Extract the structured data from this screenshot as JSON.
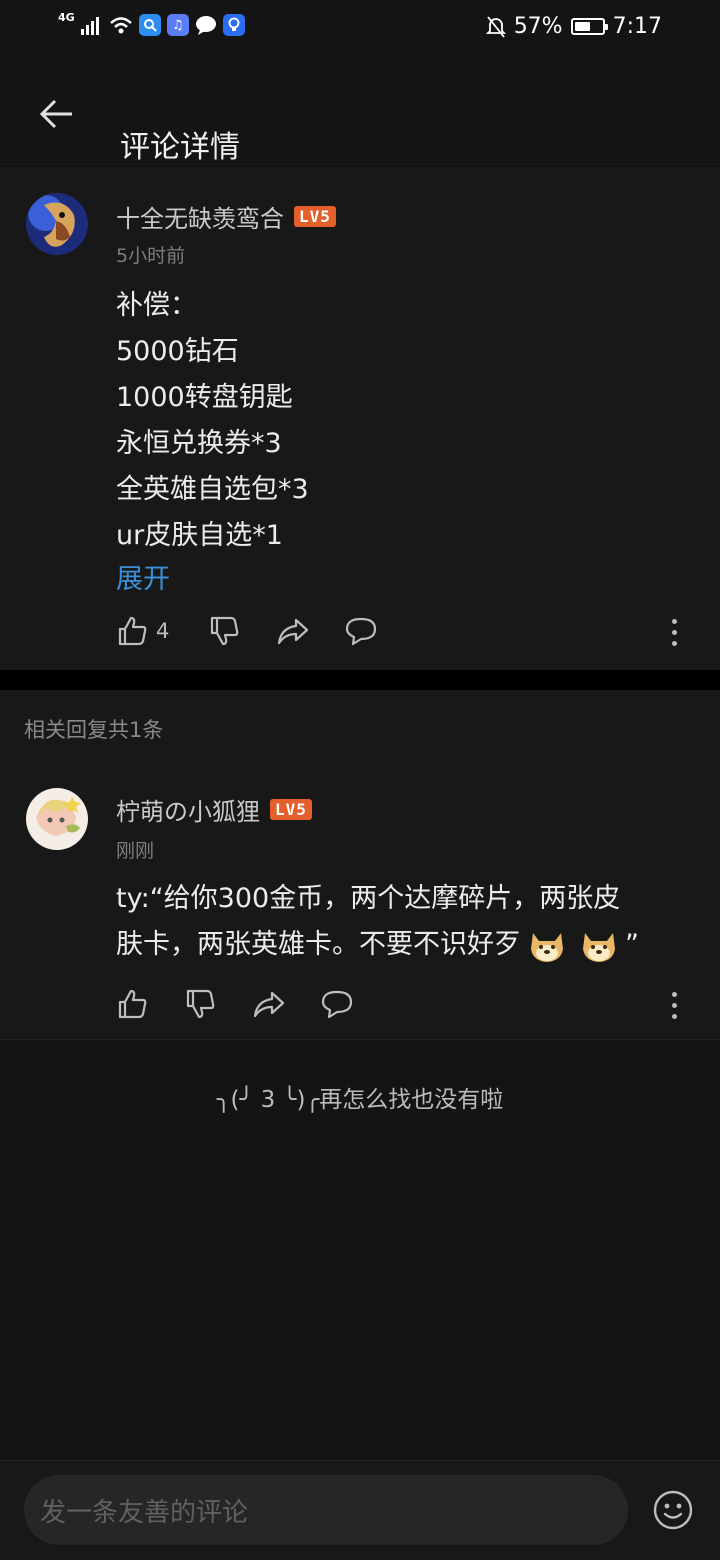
{
  "status_bar": {
    "network": "4G",
    "battery_percent": "57%",
    "battery_level": 0.57,
    "time": "7:17",
    "app_icons": [
      "search-app-icon",
      "music-app-icon",
      "message-app-icon",
      "bulb-app-icon"
    ]
  },
  "header": {
    "title": "评论详情",
    "back_icon": "arrow-left-icon"
  },
  "main_comment": {
    "username": "十全无缺羡鸾合",
    "level": "LV5",
    "time": "5小时前",
    "lines": [
      "补偿：",
      "5000钻石",
      "1000转盘钥匙",
      "永恒兑换券*3",
      "全英雄自选包*3",
      "ur皮肤自选*1"
    ],
    "expand": "展开",
    "like_count": "4"
  },
  "replies_section": {
    "label": "相关回复共1条"
  },
  "reply": {
    "username": "柠萌の小狐狸",
    "level": "LV5",
    "time": "刚刚",
    "line1": "ty:“给你300金币，两个达摩碎片，两张皮",
    "line2": "肤卡，两张英雄卡。不要不识好歹",
    "line2_end": "”",
    "emoji": "doge-emoji"
  },
  "end_message": "╮(╯ 3 ╰)╭再怎么找也没有啦",
  "bottom": {
    "input_placeholder": "发一条友善的评论",
    "emoji_icon": "smiley-icon"
  },
  "colors": {
    "background": "#141414",
    "card": "#181818",
    "link": "#3a8fd8",
    "level_badge": "#e3602b"
  }
}
